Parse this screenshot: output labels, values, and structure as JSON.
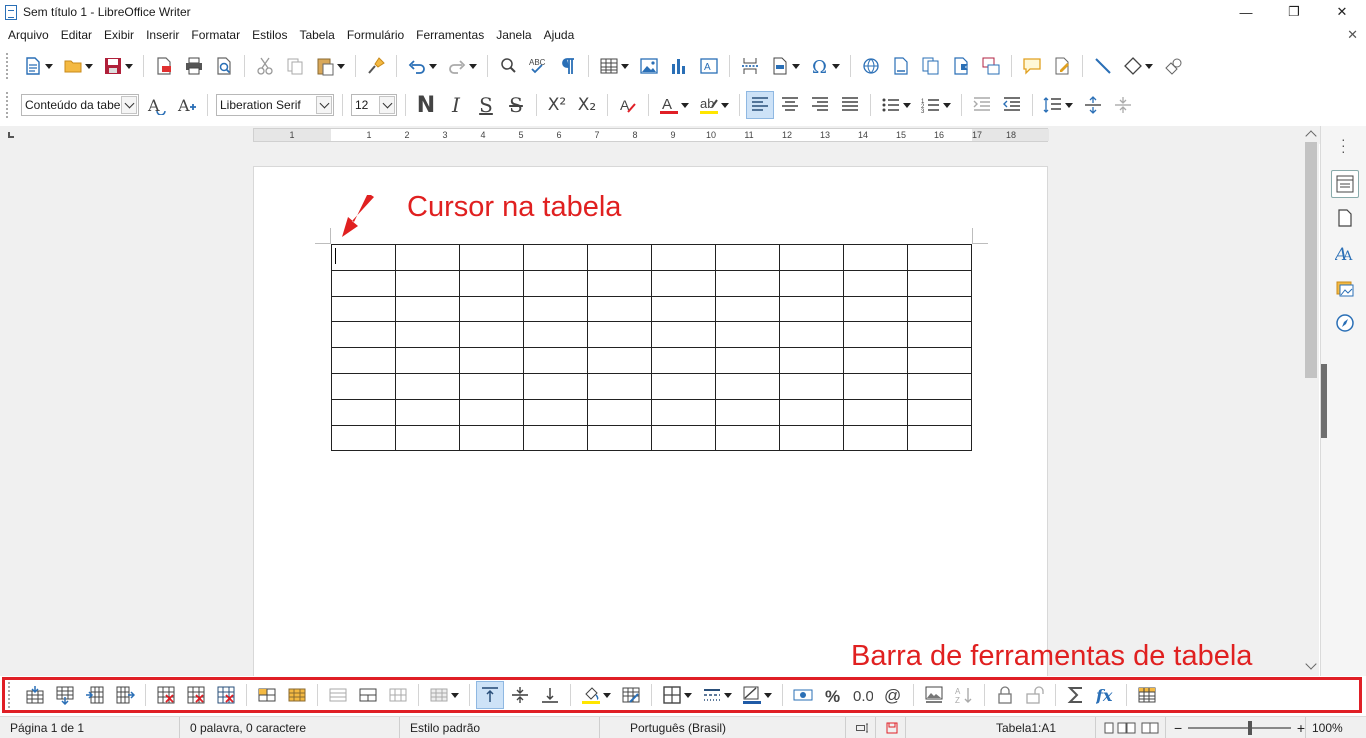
{
  "window": {
    "title": "Sem título 1 - LibreOffice Writer",
    "buttons": [
      "—",
      "❐",
      "✕"
    ]
  },
  "menu": {
    "items": [
      {
        "label": "Arquivo"
      },
      {
        "label": "Editar"
      },
      {
        "label": "Exibir"
      },
      {
        "label": "Inserir"
      },
      {
        "label": "Formatar"
      },
      {
        "label": "Estilos"
      },
      {
        "label": "Tabela"
      },
      {
        "label": "Formulário"
      },
      {
        "label": "Ferramentas"
      },
      {
        "label": "Janela"
      },
      {
        "label": "Ajuda"
      }
    ],
    "close_doc": "✕"
  },
  "formatting": {
    "paragraph_style": "Conteúdo da tabela",
    "font_name": "Liberation Serif",
    "font_size": "12",
    "bold": "N",
    "italic": "I",
    "underline": "S",
    "strike": "S",
    "superscript": "X²",
    "subscript": "X₂",
    "font_color": "#e01f26",
    "highlight_color": "#ffe600",
    "border_color": "#1f5aa6",
    "cell_bg_color": "#ffe600"
  },
  "ruler": {
    "labels": [
      "1",
      "1",
      "2",
      "3",
      "4",
      "5",
      "6",
      "7",
      "8",
      "9",
      "10",
      "11",
      "12",
      "13",
      "14",
      "15",
      "16",
      "17",
      "18"
    ]
  },
  "annotations": {
    "cursor_label": "Cursor na tabela",
    "toolbar_label": "Barra de ferramentas de tabela",
    "color": "#e02020"
  },
  "table": {
    "rows": 8,
    "cols": 10
  },
  "statusbar": {
    "page": "Página 1 de 1",
    "words": "0 palavra, 0 caractere",
    "style": "Estilo padrão",
    "language": "Português (Brasil)",
    "cell": "Tabela1:A1",
    "zoom": "100%",
    "zoom_minus": "−",
    "zoom_plus": "+"
  }
}
